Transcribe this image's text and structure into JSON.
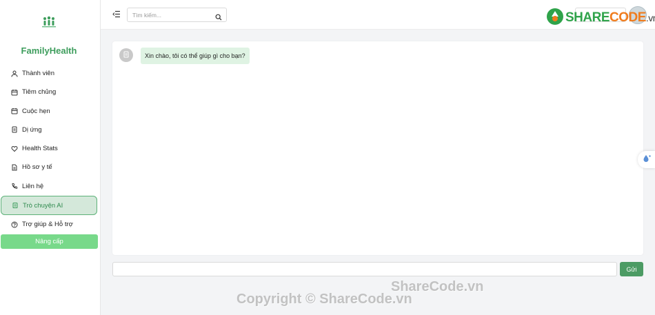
{
  "brand": {
    "name": "FamilyHealth",
    "icon": "family-icon",
    "color": "#3d9d5c"
  },
  "sidebar": {
    "items": [
      {
        "label": "Thành viên",
        "icon": "user-icon"
      },
      {
        "label": "Tiêm chủng",
        "icon": "calendar-icon"
      },
      {
        "label": "Cuộc hẹn",
        "icon": "calendar-icon"
      },
      {
        "label": "Dị ứng",
        "icon": "clipboard-icon"
      },
      {
        "label": "Health Stats",
        "icon": "heart-icon"
      },
      {
        "label": "Hồ sơ y tế",
        "icon": "file-icon"
      },
      {
        "label": "Liên hệ",
        "icon": "phone-icon"
      },
      {
        "label": "Trò chuyện AI",
        "icon": "robot-icon",
        "active": true
      },
      {
        "label": "Trợ giúp & Hỗ trợ",
        "icon": "help-icon"
      }
    ],
    "upgrade_label": "Nâng cấp"
  },
  "header": {
    "search_placeholder": "Tìm kiếm..."
  },
  "chat": {
    "messages": [
      {
        "sender": "bot",
        "text": "Xin chào, tôi có thể giúp gì cho bạn?"
      }
    ],
    "input_placeholder": "",
    "send_label": "Gửi"
  },
  "watermark": {
    "logo_part1": "SHARE",
    "logo_part2": "CODE",
    "logo_part3": ".vn",
    "text1": "ShareCode.vn",
    "text2": "Copyright © ShareCode.vn"
  },
  "colors": {
    "accent": "#4c9b64",
    "active_bg": "#d4e8da",
    "upgrade_bg": "#78d98a",
    "bubble_bg": "#dff3e3"
  }
}
